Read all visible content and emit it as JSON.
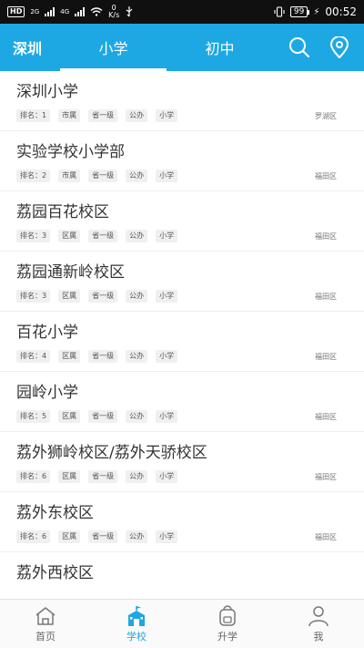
{
  "status_bar": {
    "hd_label": "HD",
    "net_label_1": "2G",
    "net_label_2": "4G",
    "speed_value": "0",
    "speed_unit": "K/s",
    "battery": "99",
    "time": "00:52"
  },
  "header": {
    "city": "深圳",
    "tabs": [
      {
        "label": "小学"
      },
      {
        "label": "初中"
      }
    ],
    "active_tab": 0,
    "accent": "#1da8e3"
  },
  "schools": [
    {
      "name": "深圳小学",
      "rank": "排名：1",
      "owner": "市属",
      "level": "省一级",
      "type": "公办",
      "stage": "小学",
      "district": "罗湖区"
    },
    {
      "name": "实验学校小学部",
      "rank": "排名：2",
      "owner": "市属",
      "level": "省一级",
      "type": "公办",
      "stage": "小学",
      "district": "福田区"
    },
    {
      "name": "荔园百花校区",
      "rank": "排名：3",
      "owner": "区属",
      "level": "省一级",
      "type": "公办",
      "stage": "小学",
      "district": "福田区"
    },
    {
      "name": "荔园通新岭校区",
      "rank": "排名：3",
      "owner": "区属",
      "level": "省一级",
      "type": "公办",
      "stage": "小学",
      "district": "福田区"
    },
    {
      "name": "百花小学",
      "rank": "排名：4",
      "owner": "区属",
      "level": "省一级",
      "type": "公办",
      "stage": "小学",
      "district": "福田区"
    },
    {
      "name": "园岭小学",
      "rank": "排名：5",
      "owner": "区属",
      "level": "省一级",
      "type": "公办",
      "stage": "小学",
      "district": "福田区"
    },
    {
      "name": "荔外狮岭校区/荔外天骄校区",
      "rank": "排名：6",
      "owner": "区属",
      "level": "省一级",
      "type": "公办",
      "stage": "小学",
      "district": "福田区"
    },
    {
      "name": "荔外东校区",
      "rank": "排名：6",
      "owner": "区属",
      "level": "省一级",
      "type": "公办",
      "stage": "小学",
      "district": "福田区"
    },
    {
      "name": "荔外西校区",
      "rank": "",
      "owner": "",
      "level": "",
      "type": "",
      "stage": "",
      "district": ""
    }
  ],
  "bottom_nav": [
    {
      "label": "首页",
      "icon": "home-icon"
    },
    {
      "label": "学校",
      "icon": "school-icon"
    },
    {
      "label": "升学",
      "icon": "backpack-icon"
    },
    {
      "label": "我",
      "icon": "user-icon"
    }
  ],
  "bottom_nav_active": 1
}
